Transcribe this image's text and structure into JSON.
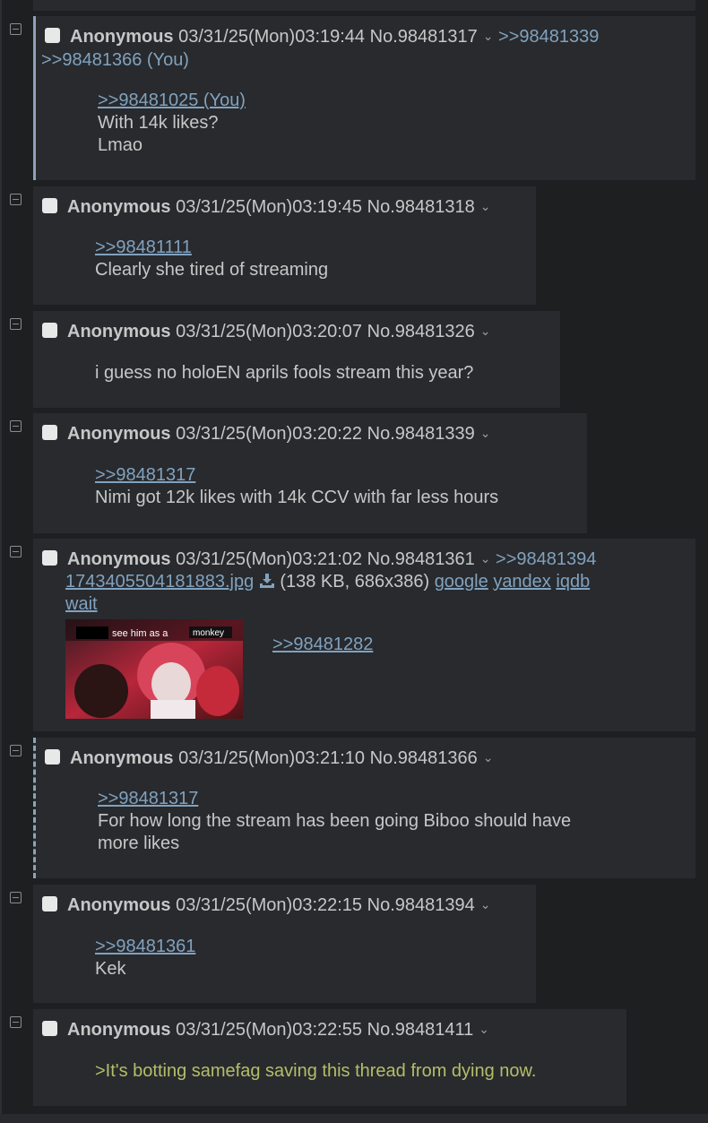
{
  "thread": {
    "posts": [
      {
        "name": "Anonymous",
        "date": "03/31/25(Mon)03:19:44",
        "no": "No.98481317",
        "backlinks": [
          ">>98481339",
          ">>98481366 (You)"
        ],
        "quotes": [
          ">>98481025 (You)"
        ],
        "lines": [
          "With 14k likes?",
          "Lmao"
        ]
      },
      {
        "name": "Anonymous",
        "date": "03/31/25(Mon)03:19:45",
        "no": "No.98481318",
        "backlinks": [],
        "quotes": [
          ">>98481111"
        ],
        "lines": [
          "Clearly she tired of streaming"
        ]
      },
      {
        "name": "Anonymous",
        "date": "03/31/25(Mon)03:20:07",
        "no": "No.98481326",
        "backlinks": [],
        "quotes": [],
        "lines": [
          "i guess no holoEN aprils fools stream this year?"
        ]
      },
      {
        "name": "Anonymous",
        "date": "03/31/25(Mon)03:20:22",
        "no": "No.98481339",
        "backlinks": [],
        "quotes": [
          ">>98481317"
        ],
        "lines": [
          "Nimi got 12k likes with 14k CCV with far less hours"
        ]
      },
      {
        "name": "Anonymous",
        "date": "03/31/25(Mon)03:21:02",
        "no": "No.98481361",
        "backlinks": [
          ">>98481394"
        ],
        "file": {
          "filename": "1743405504181883.jpg",
          "info": "(138 KB, 686x386)",
          "search": [
            "google",
            "yandex",
            "iqdb"
          ],
          "extra": "wait",
          "thumb_caption_1": "see him as a",
          "thumb_caption_2": "monkey"
        },
        "quotes": [
          ">>98481282"
        ],
        "lines": []
      },
      {
        "name": "Anonymous",
        "date": "03/31/25(Mon)03:21:10",
        "no": "No.98481366",
        "backlinks": [],
        "quotes": [
          ">>98481317"
        ],
        "lines": [
          "For how long the stream has been going Biboo should have",
          "more likes"
        ]
      },
      {
        "name": "Anonymous",
        "date": "03/31/25(Mon)03:22:15",
        "no": "No.98481394",
        "backlinks": [],
        "quotes": [
          ">>98481361"
        ],
        "lines": [
          "Kek"
        ]
      },
      {
        "name": "Anonymous",
        "date": "03/31/25(Mon)03:22:55",
        "no": "No.98481411",
        "backlinks": [],
        "quotes": [],
        "greentext": ">It's botting samefag saving this thread from dying now.",
        "lines": []
      }
    ]
  },
  "icons": {
    "hide": "minus-box-icon",
    "menu": "chevron-down-icon",
    "download": "download-icon"
  },
  "colors": {
    "bg": "#1d1f21",
    "post_bg": "#282a2e",
    "link": "#81a2be",
    "greentext": "#b5bd68",
    "text": "#c5c8c6"
  }
}
